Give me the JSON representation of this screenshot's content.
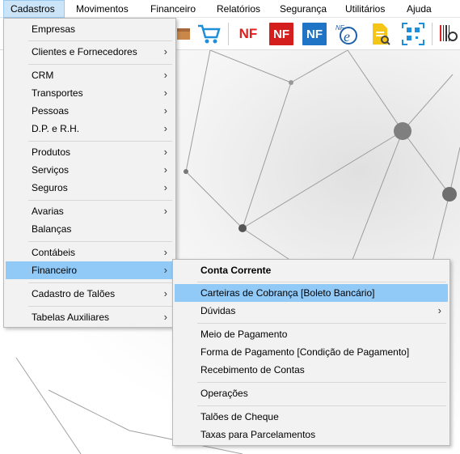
{
  "menubar": {
    "items": [
      "Cadastros",
      "Movimentos",
      "Financeiro",
      "Relatórios",
      "Segurança",
      "Utilitários",
      "Ajuda"
    ]
  },
  "toolbar": {
    "nf1": "NF",
    "nf2": "NF",
    "nf3": "NF",
    "nfe_top": "NF",
    "nfe_bottom": "e",
    "colors": {
      "nf1": "#e11d1d",
      "nf2": "#d41d1d",
      "nf3": "#1f74c6"
    }
  },
  "cadastros_menu": {
    "items": [
      {
        "label": "Empresas",
        "submenu": false
      },
      {
        "label": "Clientes e Fornecedores",
        "submenu": true
      },
      {
        "label": "CRM",
        "submenu": true
      },
      {
        "label": "Transportes",
        "submenu": true
      },
      {
        "label": "Pessoas",
        "submenu": true
      },
      {
        "label": "D.P. e R.H.",
        "submenu": true
      },
      {
        "label": "Produtos",
        "submenu": true
      },
      {
        "label": "Serviços",
        "submenu": true
      },
      {
        "label": "Seguros",
        "submenu": true
      },
      {
        "label": "Avarias",
        "submenu": true
      },
      {
        "label": "Balanças",
        "submenu": false
      },
      {
        "label": "Contábeis",
        "submenu": true
      },
      {
        "label": "Financeiro",
        "submenu": true
      },
      {
        "label": "Cadastro de Talões",
        "submenu": true
      },
      {
        "label": "Tabelas Auxiliares",
        "submenu": true
      }
    ],
    "arrow": "›"
  },
  "financeiro_submenu": {
    "items": [
      {
        "label": "Conta Corrente",
        "bold": true
      },
      {
        "label": "Carteiras de Cobrança [Boleto Bancário]"
      },
      {
        "label": "Dúvidas",
        "submenu": true
      },
      {
        "label": "Meio de Pagamento"
      },
      {
        "label": "Forma de Pagamento [Condição de Pagamento]"
      },
      {
        "label": "Recebimento de Contas"
      },
      {
        "label": "Operações"
      },
      {
        "label": "Talões de Cheque"
      },
      {
        "label": "Taxas para Parcelamentos"
      }
    ],
    "arrow": "›"
  }
}
